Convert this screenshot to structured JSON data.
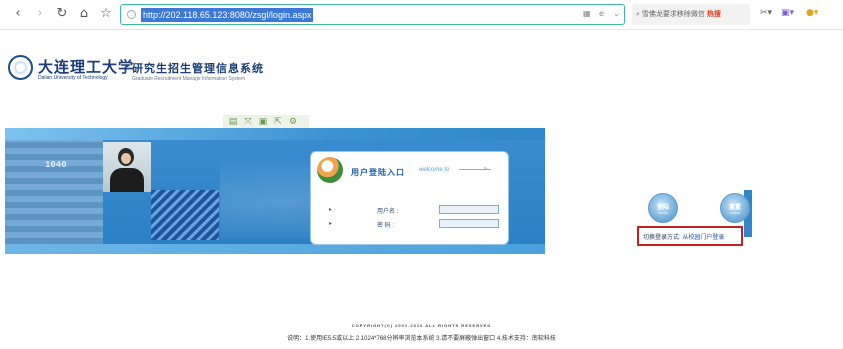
{
  "browser": {
    "address": "http://202.118.65.123:8080/zsgl/login.aspx",
    "search_text": "雪佛龙要求移除微信",
    "search_hot": "热搜"
  },
  "header": {
    "university_cn": "大连理工大学",
    "university_en": "Dalian University of Technology",
    "system_cn": "研究生招生管理信息系统",
    "system_en": "Graduate Recruitment Manage Information System"
  },
  "banner": {
    "doc_number": "1040"
  },
  "login": {
    "title": "用户登陆入口",
    "welcome": "welcome to",
    "username_label": "用户名 :",
    "password_label": "密  码 :",
    "username_value": "",
    "password_value": ""
  },
  "buttons": {
    "login_label": "登陆",
    "login_sub": "LOGIN",
    "reset_label": "重置",
    "reset_sub": "CLEAR"
  },
  "switch": {
    "label": "切换登录方式: ",
    "link": "从校园门户登录"
  },
  "footer": {
    "copyright": "COPYRIGHT(C) 2001-2010 ALL RIGHTS RESERVED",
    "notice": "说明：1.使用IE5.5或以上 2.1024*768分辨率浏览本系统 3.请不要屏蔽弹出窗口 4.技术支持：南软科技"
  }
}
